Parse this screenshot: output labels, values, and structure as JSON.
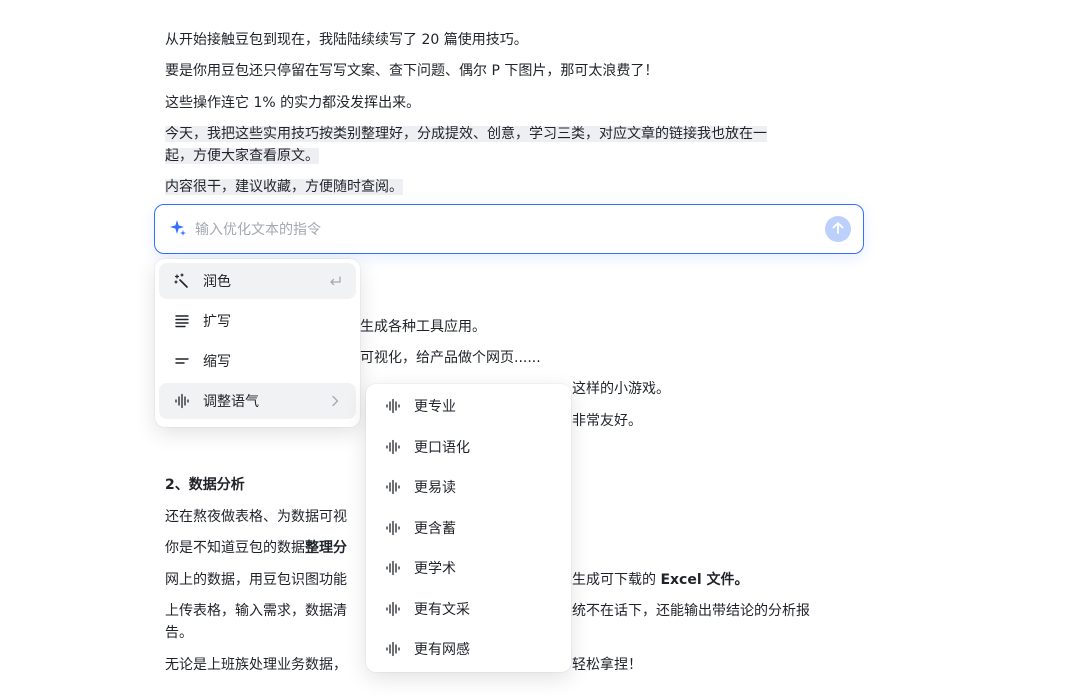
{
  "document": {
    "p1": "从开始接触豆包到现在，我陆陆续续写了 20 篇使用技巧。",
    "p2": "要是你用豆包还只停留在写写文案、查下问题、偶尔 P 下图片，那可太浪费了！",
    "p3": "这些操作连它 1% 的实力都没发挥出来。",
    "p4_line1": "今天，我把这些实用技巧按类别整理好，分成提效、创意，学习三类，对应文章的链接我也放在一",
    "p4_line2": "起，方便大家查看原文。",
    "p5": "内容很干，建议收藏，方便随时查阅。",
    "behind1": "生成各种工具应用。",
    "behind2": "可视化，给产品做个网页......",
    "behind3": "这样的小游戏。",
    "behind4": "非常友好。",
    "h2": "2、数据分析",
    "d1": "还在熬夜做表格、为数据可视",
    "d2a": "你是不知道豆包的数据",
    "d2b": "整理分",
    "d3a": "网上的数据，用豆包识图功能",
    "d3b": "生成可下载的 ",
    "d3c": "Excel 文件。",
    "d4a": "上传表格，输入需求，数据清",
    "d4b": "统不在话下，还能输出带结论的分析报",
    "d4c": "告。",
    "d5a": "无论是上班族处理业务数据，",
    "d5b": "轻松拿捏！"
  },
  "prompt": {
    "placeholder": "输入优化文本的指令",
    "icon": "sparkle-icon",
    "send_icon": "arrow-up-icon",
    "accent": "#3370ff"
  },
  "menu": {
    "items": [
      {
        "label": "润色",
        "icon": "magic-wand-icon",
        "trail": "enter-icon"
      },
      {
        "label": "扩写",
        "icon": "lines-expand-icon"
      },
      {
        "label": "缩写",
        "icon": "lines-shorten-icon"
      },
      {
        "label": "调整语气",
        "icon": "waveform-icon",
        "trail": "chevron-right-icon"
      }
    ]
  },
  "submenu": {
    "items": [
      {
        "label": "更专业",
        "icon": "waveform-icon"
      },
      {
        "label": "更口语化",
        "icon": "waveform-icon"
      },
      {
        "label": "更易读",
        "icon": "waveform-icon"
      },
      {
        "label": "更含蓄",
        "icon": "waveform-icon"
      },
      {
        "label": "更学术",
        "icon": "waveform-icon"
      },
      {
        "label": "更有文采",
        "icon": "waveform-icon"
      },
      {
        "label": "更有网感",
        "icon": "waveform-icon"
      }
    ]
  }
}
